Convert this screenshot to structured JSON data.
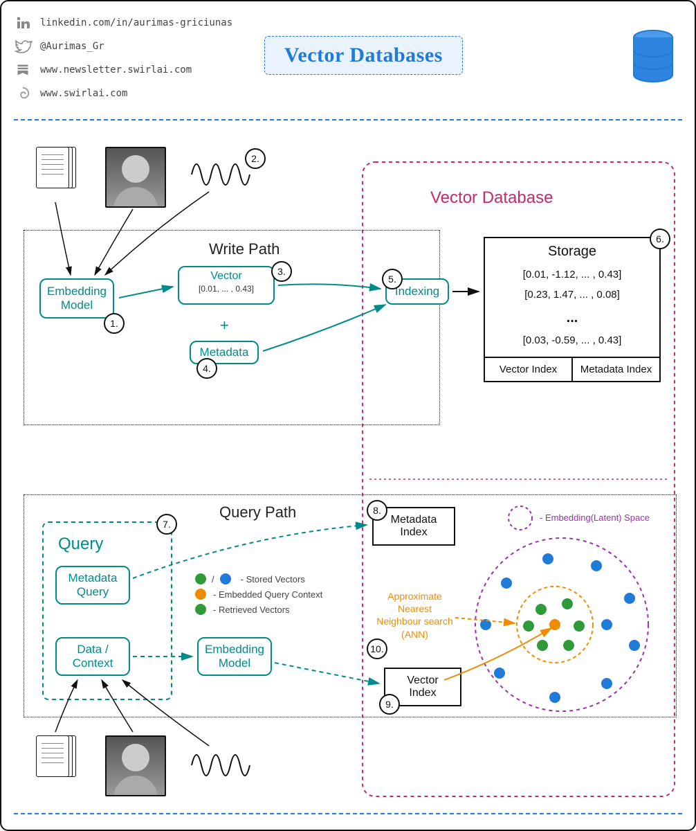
{
  "header": {
    "title": "Vector Databases",
    "social": {
      "linkedin": "linkedin.com/in/aurimas-griciunas",
      "twitter": "@Aurimas_Gr",
      "newsletter": "www.newsletter.swirlai.com",
      "site": "www.swirlai.com"
    }
  },
  "vectorDatabaseLabel": "Vector Database",
  "writePath": {
    "label": "Write Path",
    "embeddingModel": "Embedding Model",
    "vectorLabel": "Vector",
    "vectorExample": "[0.01, ... , 0.43]",
    "plus": "+",
    "metadata": "Metadata",
    "indexing": "Indexing"
  },
  "storage": {
    "title": "Storage",
    "rows": [
      "[0.01, -1.12, ... , 0.43]",
      "[0.23, 1.47, ... , 0.08]",
      "...",
      "[0.03, -0.59, ... , 0.43]"
    ],
    "vectorIndex": "Vector Index",
    "metadataIndex": "Metadata Index"
  },
  "queryPath": {
    "label": "Query Path",
    "queryHeader": "Query",
    "metadataQuery": "Metadata Query",
    "dataContext": "Data / Context",
    "embeddingModel": "Embedding Model",
    "metadataIndex": "Metadata Index",
    "vectorIndex": "Vector Index",
    "ann": "Approximate Nearest Neighbour search (ANN)",
    "latentSpace": "- Embedding(Latent) Space"
  },
  "legend": {
    "stored": "- Stored Vectors",
    "embedded": "- Embedded Query Context",
    "retrieved": "- Retrieved Vectors",
    "slash": "/"
  },
  "numbers": {
    "n1": "1.",
    "n2": "2.",
    "n3": "3.",
    "n4": "4.",
    "n5": "5.",
    "n6": "6.",
    "n7": "7.",
    "n8": "8.",
    "n9": "9.",
    "n10": "10."
  }
}
